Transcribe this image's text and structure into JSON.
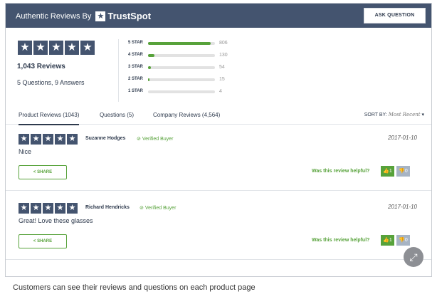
{
  "header": {
    "authentic_label": "Authentic Reviews By",
    "brand_name": "TrustSpot",
    "ask_question": "ASK QUESTION",
    "bg_color": "#44546f"
  },
  "summary": {
    "rating_stars": 5,
    "reviews_count": "1,043 Reviews",
    "qa_count": "5 Questions, 9 Answers"
  },
  "distribution": [
    {
      "label": "5 STAR",
      "count": "806",
      "fraction": 0.94
    },
    {
      "label": "4 STAR",
      "count": "130",
      "fraction": 0.1
    },
    {
      "label": "3 STAR",
      "count": "54",
      "fraction": 0.04
    },
    {
      "label": "2 STAR",
      "count": "15",
      "fraction": 0.02
    },
    {
      "label": "1 STAR",
      "count": "4",
      "fraction": 0.0
    }
  ],
  "tabs": {
    "product_reviews": "Product Reviews (1043)",
    "questions": "Questions (5)",
    "company_reviews": "Company Reviews (4,564)",
    "sort_label": "SORT BY:",
    "sort_value": "Most Recent"
  },
  "reviews": [
    {
      "name": "Suzanne Hodges",
      "verified": "Verified Buyer",
      "date": "2017-01-10",
      "body": "Nice",
      "share": "SHARE",
      "helpful": "Was this review helpful?",
      "up": "1",
      "down": "0"
    },
    {
      "name": "Richard Hendricks",
      "verified": "Verified Buyer",
      "date": "2017-01-10",
      "body": "Great! Love these glasses",
      "share": "SHARE",
      "helpful": "Was this review helpful?",
      "up": "1",
      "down": "0"
    }
  ],
  "icons": {
    "star": "star-icon",
    "check": "check-circle-icon",
    "share": "share-icon",
    "thumbs_up": "thumbs-up-icon",
    "thumbs_down": "thumbs-down-icon",
    "expand": "expand-icon"
  },
  "colors": {
    "accent_green": "#57a23a",
    "navy": "#44546f"
  },
  "caption": "Customers can see their reviews and questions on each product page"
}
